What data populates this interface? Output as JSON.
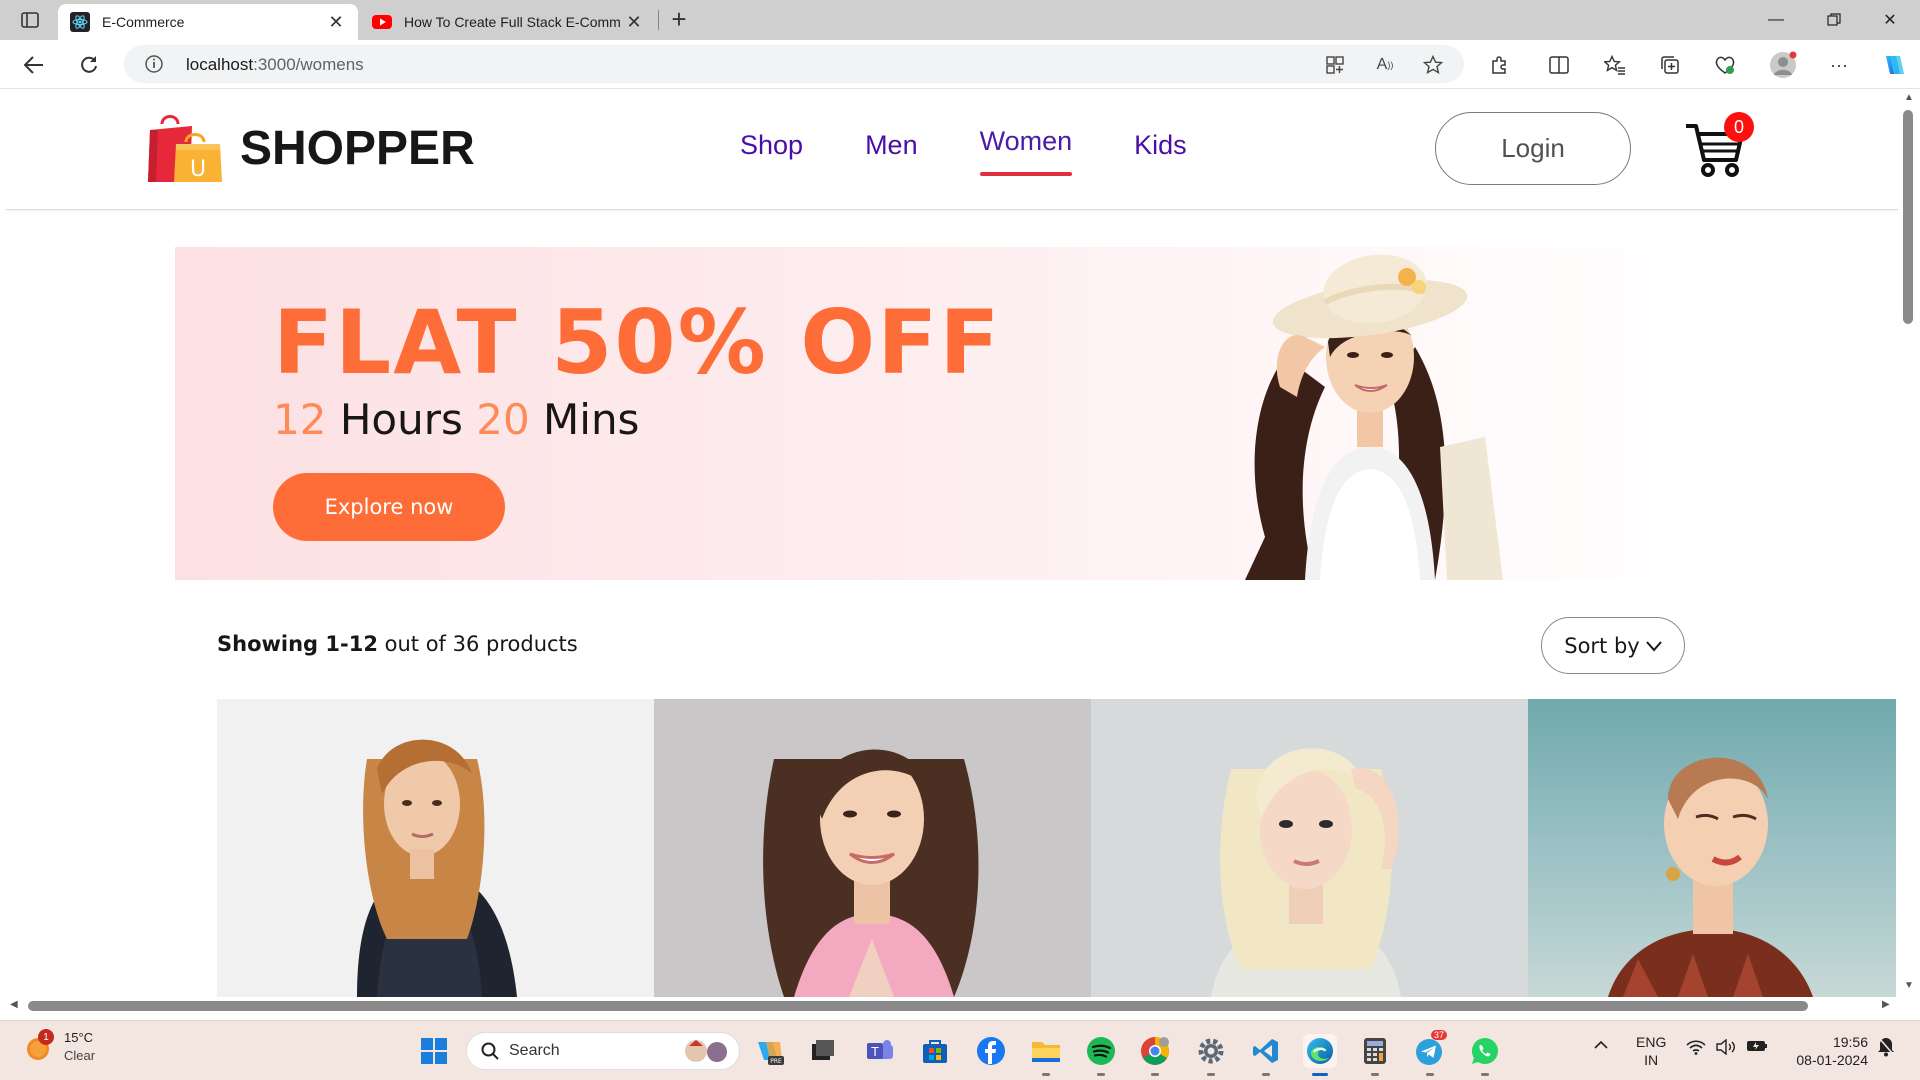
{
  "browser": {
    "tabs": [
      {
        "title": "E-Commerce",
        "favicon": "react-icon",
        "active": true
      },
      {
        "title": "How To Create Full Stack E-Comm",
        "favicon": "youtube-icon",
        "active": false
      }
    ],
    "url_host": "localhost",
    "url_path": ":3000/womens"
  },
  "site": {
    "logo_text": "SHOPPER",
    "menu": [
      "Shop",
      "Men",
      "Women",
      "Kids"
    ],
    "active_menu": "Women",
    "login_label": "Login",
    "cart_count": "0"
  },
  "banner": {
    "headline": "FLAT 50% OFF",
    "timer_hours": "12",
    "timer_hours_label": "Hours",
    "timer_mins": "20",
    "timer_mins_label": "Mins",
    "cta": "Explore now"
  },
  "listing": {
    "showing_bold": "Showing 1-12",
    "showing_rest": " out of 36 products",
    "sort_label": "Sort by"
  },
  "taskbar": {
    "weather_temp": "15°C",
    "weather_cond": "Clear",
    "weather_badge": "1",
    "search_label": "Search",
    "telegram_badge": "37",
    "lang_1": "ENG",
    "lang_2": "IN",
    "time": "19:56",
    "date": "08-01-2024"
  },
  "colors": {
    "accent_orange": "#fe6d37",
    "menu_purple": "#4a0ea8",
    "active_underline": "#e03040",
    "cart_badge": "#ff1010"
  }
}
